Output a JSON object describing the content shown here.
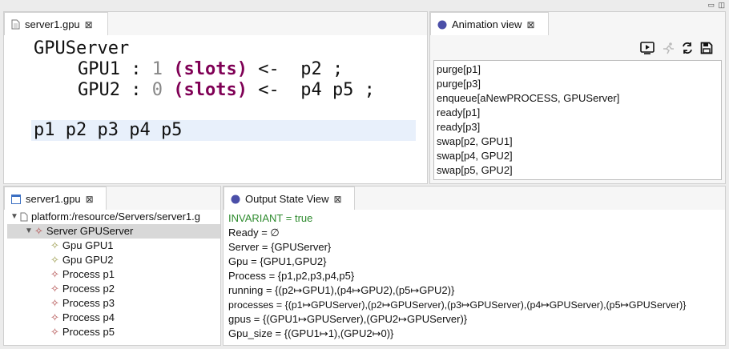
{
  "window_controls": "▭ ◫",
  "editor": {
    "tab_label": "server1.gpu",
    "close_glyph": "⊠",
    "line1": "GPUServer",
    "gpu1_name": "GPU1",
    "gpu1_colon": ":",
    "gpu1_count": "1",
    "gpu1_kw": "(slots)",
    "gpu1_arrow": "<-",
    "gpu1_procs": "p2 ;",
    "gpu2_name": "GPU2",
    "gpu2_colon": ":",
    "gpu2_count": "0",
    "gpu2_kw": "(slots)",
    "gpu2_arrow": "<-",
    "gpu2_procs": "p4 p5 ;",
    "processes_line": "p1 p2 p3 p4 p5"
  },
  "animation": {
    "tab_label": "Animation view",
    "close_glyph": "⊠",
    "toolbar": [
      "play-icon",
      "run-icon",
      "refresh-icon",
      "save-icon"
    ],
    "events": [
      "purge[p1]",
      "purge[p3]",
      "enqueue[aNewPROCESS, GPUServer]",
      "ready[p1]",
      "ready[p3]",
      "swap[p2, GPU1]",
      "swap[p4, GPU2]",
      "swap[p5, GPU2]"
    ]
  },
  "outline": {
    "tab_label": "server1.gpu",
    "close_glyph": "⊠",
    "root_label": "platform:/resource/Servers/server1.g",
    "server_label": "Server GPUServer",
    "gpus": [
      "Gpu GPU1",
      "Gpu GPU2"
    ],
    "processes": [
      "Process p1",
      "Process p2",
      "Process p3",
      "Process p4",
      "Process p5"
    ],
    "colors": {
      "gpu_icon": "#9a9a4a",
      "process_icon": "#b04a4a"
    }
  },
  "output": {
    "tab_label": "Output State View",
    "close_glyph": "⊠",
    "invariant": "INVARIANT = true",
    "invariant_color": "#2e8b2e",
    "lines": [
      "Ready = ∅",
      "Server = {GPUServer}",
      "Gpu = {GPU1,GPU2}",
      "Process = {p1,p2,p3,p4,p5}",
      "running = {(p2↦GPU1),(p4↦GPU2),(p5↦GPU2)}",
      "processes = {(p1↦GPUServer),(p2↦GPUServer),(p3↦GPUServer),(p4↦GPUServer),(p5↦GPUServer)}",
      "gpus = {(GPU1↦GPUServer),(GPU2↦GPUServer)}",
      "Gpu_size = {(GPU1↦1),(GPU2↦0)}"
    ]
  }
}
